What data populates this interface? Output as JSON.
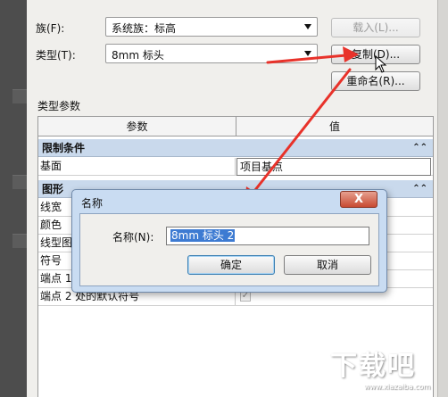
{
  "type_properties": {
    "family_label": "族(F):",
    "family_value": "系统族：标高",
    "type_label": "类型(T):",
    "type_value": "8mm 标头",
    "load_button": "载入(L)...",
    "duplicate_button": "复制(D)...",
    "rename_button": "重命名(R)...",
    "params_label": "类型参数"
  },
  "table": {
    "header_param": "参数",
    "header_value": "值",
    "groups": [
      {
        "title": "限制条件",
        "collapse_icon": "double-chevron-up"
      },
      {
        "title": "图形",
        "collapse_icon": "double-chevron-up"
      }
    ],
    "rows": [
      {
        "param": "基面",
        "value": "项目基点"
      },
      {
        "param": "线宽",
        "value": ""
      },
      {
        "param": "颜色",
        "value": ""
      },
      {
        "param": "线型图",
        "value": ""
      },
      {
        "param": "符号",
        "value": ""
      },
      {
        "param": "端点 1",
        "value": ""
      },
      {
        "param": "端点 2 处的默认符号",
        "value": "✓"
      }
    ]
  },
  "name_dialog": {
    "title": "名称",
    "close": "X",
    "name_label": "名称(N):",
    "name_value": "8mm 标头 2",
    "ok": "确定",
    "cancel": "取消"
  },
  "watermark": {
    "main": "下载吧",
    "sub": "www.xiazaiba.com"
  },
  "annotation_color": "#e8322a"
}
